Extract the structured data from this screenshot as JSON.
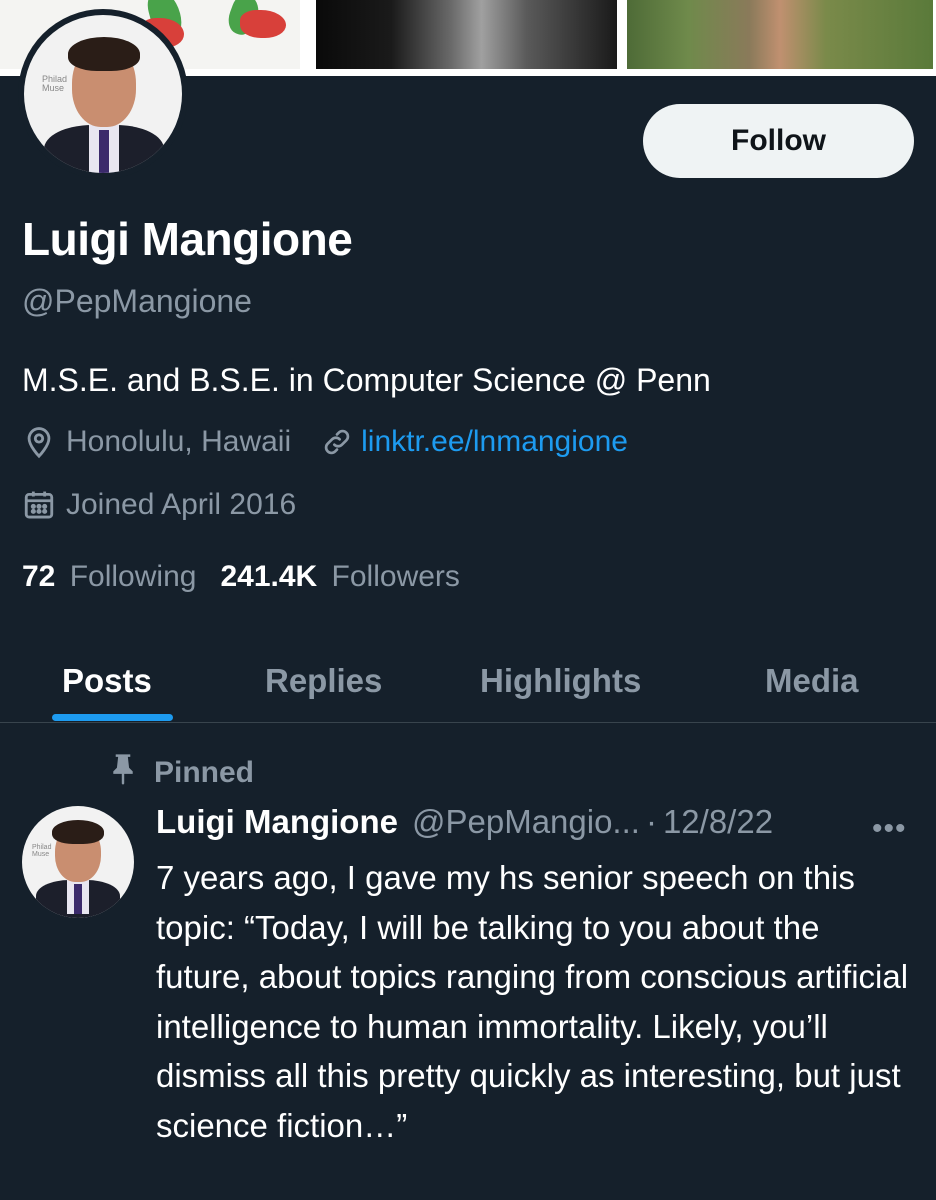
{
  "profile": {
    "name": "Luigi Mangione",
    "handle": "@PepMangione",
    "bio": "M.S.E. and B.S.E. in Computer Science @ Penn",
    "location": "Honolulu, Hawaii",
    "website": "linktr.ee/lnmangione",
    "joined": "Joined April 2016",
    "following_count": "72",
    "following_label": "Following",
    "followers_count": "241.4K",
    "followers_label": "Followers",
    "avatar_watermark": "Philad Muse"
  },
  "actions": {
    "follow_label": "Follow"
  },
  "tabs": [
    {
      "label": "Posts",
      "active": true
    },
    {
      "label": "Replies",
      "active": false
    },
    {
      "label": "Highlights",
      "active": false
    },
    {
      "label": "Media",
      "active": false
    }
  ],
  "pinned_post": {
    "pinned_label": "Pinned",
    "author_name": "Luigi Mangione",
    "author_handle": "@PepMangio...",
    "separator": "·",
    "date": "12/8/22",
    "more_label": "•••",
    "text": "7 years ago, I gave my hs senior speech on this topic: “Today, I will be talking to you about the future, about topics ranging from conscious artificial intelligence to human immortality. Likely, you’ll dismiss all this pretty quickly as interesting, but just science fiction…”"
  },
  "colors": {
    "background": "#15202b",
    "accent": "#1d9bf0",
    "muted_text": "#8b98a5",
    "divider": "#38444d",
    "button_bg": "#eff3f4"
  },
  "icons": {
    "location": "location-pin-icon",
    "link": "link-icon",
    "calendar": "calendar-icon",
    "pin": "pin-icon",
    "more": "more-horizontal-icon"
  }
}
